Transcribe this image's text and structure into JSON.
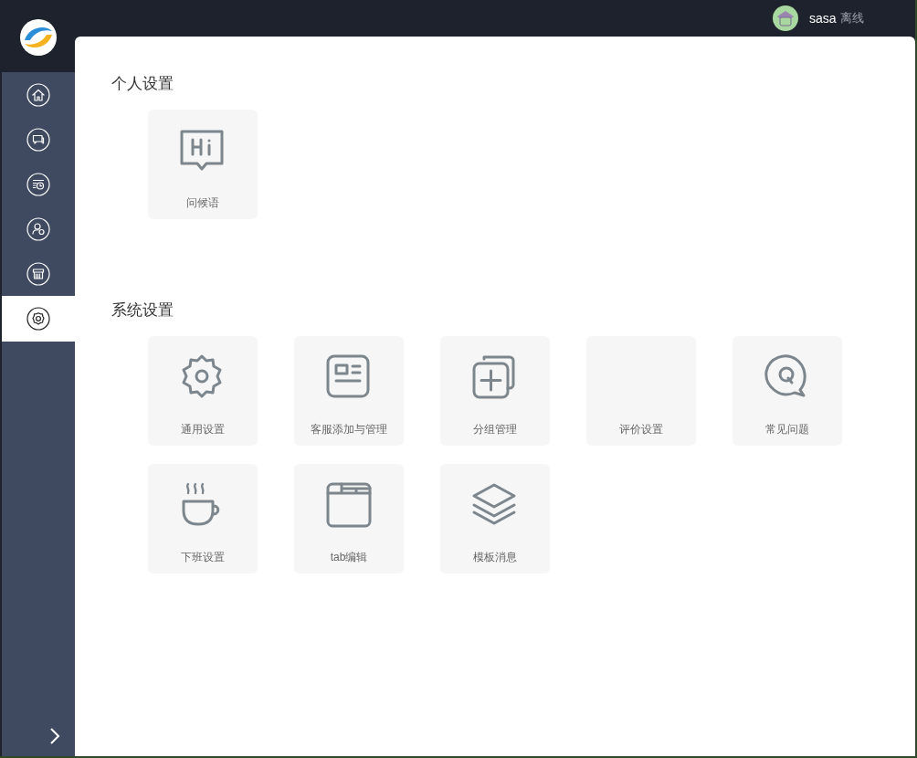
{
  "user": {
    "name": "sasa",
    "status": "离线"
  },
  "sidebar": {
    "items": [
      {
        "kind": "home",
        "selected": false
      },
      {
        "kind": "chat",
        "selected": false
      },
      {
        "kind": "history",
        "selected": false
      },
      {
        "kind": "user",
        "selected": false
      },
      {
        "kind": "store",
        "selected": false
      },
      {
        "kind": "settings",
        "selected": true
      }
    ]
  },
  "sections": [
    {
      "title": "个人设置",
      "tiles": [
        {
          "label": "问候语",
          "kind": "hi"
        }
      ]
    },
    {
      "title": "系统设置",
      "tiles": [
        {
          "label": "通用设置",
          "kind": "gear"
        },
        {
          "label": "客服添加与管理",
          "kind": "card"
        },
        {
          "label": "分组管理",
          "kind": "add"
        },
        {
          "label": "评价设置",
          "kind": "none"
        },
        {
          "label": "常见问题",
          "kind": "question"
        },
        {
          "label": "下班设置",
          "kind": "cup"
        },
        {
          "label": "tab编辑",
          "kind": "folder"
        },
        {
          "label": "模板消息",
          "kind": "layers"
        }
      ]
    }
  ]
}
